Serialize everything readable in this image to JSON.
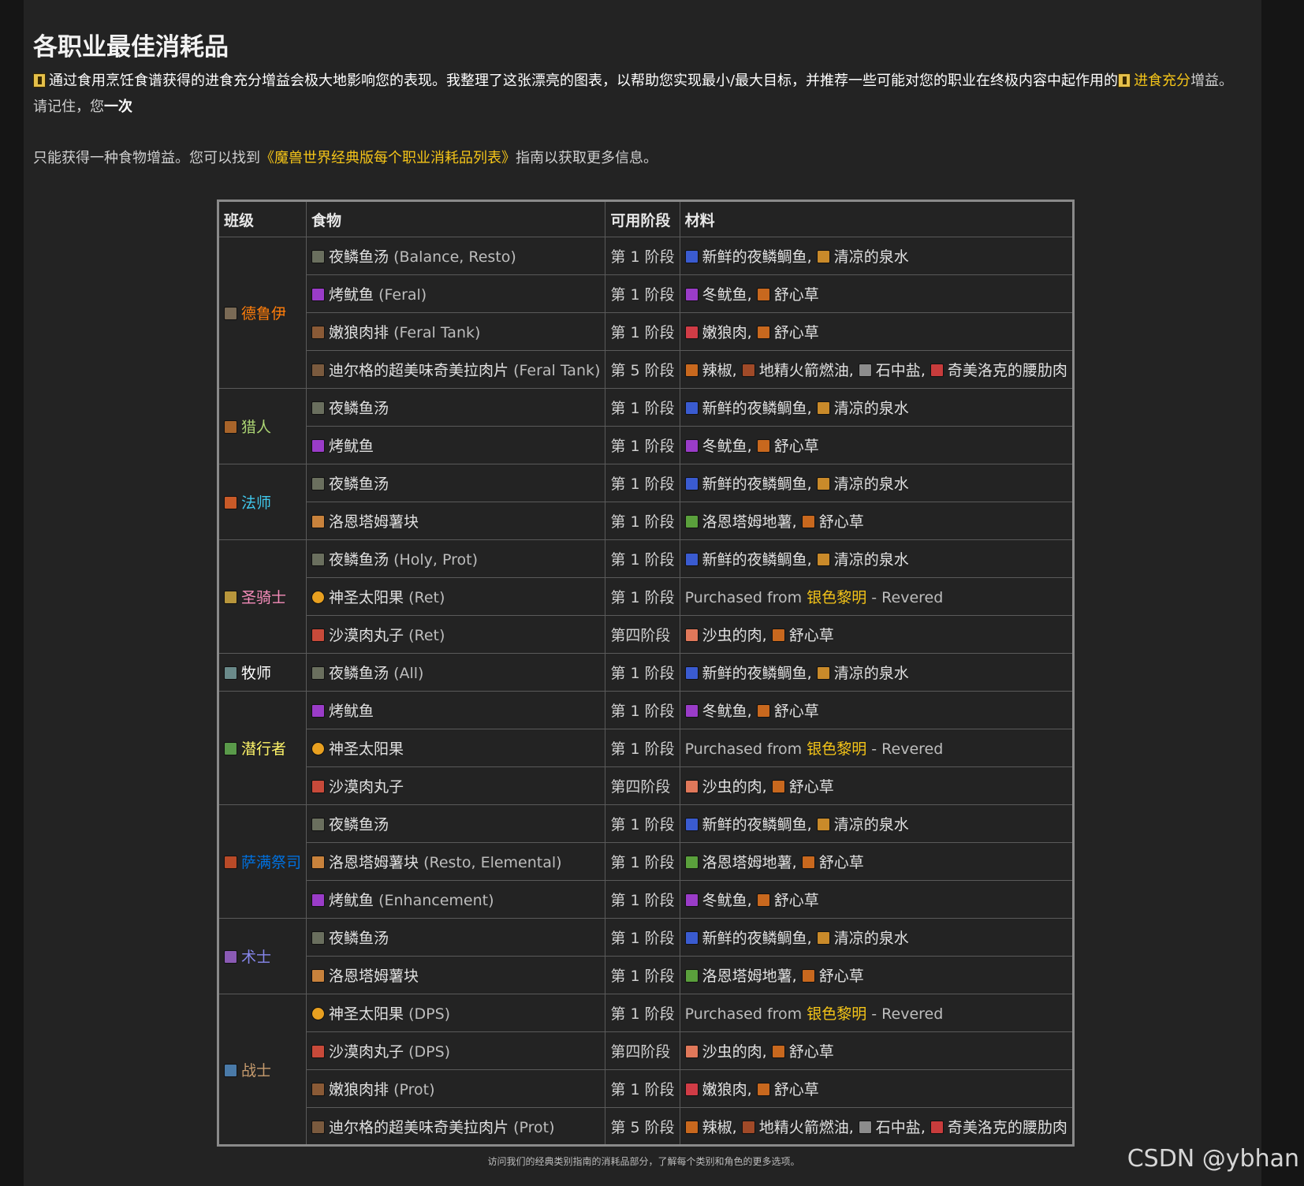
{
  "page": {
    "title": "各职业最佳消耗品",
    "intro": {
      "prefix": "通过食用烹饪食谱获得的进食充分增益会极大地影响您的表现。我整理了这张漂亮的图表，以帮助您实现最小/最大目标，并推荐一些可能对您的职业在终极内容中起作用的",
      "link": "进食充分",
      "suffix": "增益。请记住，您",
      "strong": "一次"
    },
    "line2": {
      "prefix": "只能获得一种食物增益。您可以找到",
      "link": "《魔兽世界经典版每个职业消耗品列表》",
      "suffix": "指南以获取更多信息。"
    },
    "caption": "访问我们的经典类别指南的消耗品部分，了解每个类别和角色的更多选项。",
    "watermark": "CSDN @ybhan"
  },
  "table": {
    "headers": [
      "班级",
      "食物",
      "可用阶段",
      "材料"
    ],
    "purchase": {
      "prefix": "Purchased from ",
      "faction": "银色黎明",
      "suffix": " - Revered"
    },
    "groups": [
      {
        "cls": "德鲁伊",
        "color": "#ff7d0a",
        "icon": "#7a6a55",
        "rows": [
          {
            "food": "夜鳞鱼汤",
            "note": " (Balance, Resto)",
            "ficon": "#6a6f5e",
            "phase": "第 1 阶段",
            "pc": "",
            "mats": [
              {
                "n": "新鲜的夜鳞鲷鱼",
                "c": "#3a5bd0"
              },
              {
                "n": "清凉的泉水",
                "c": "#c98a2a"
              }
            ]
          },
          {
            "food": "烤鱿鱼",
            "note": " (Feral)",
            "ficon": "#9a3cc8",
            "phase": "第 1 阶段",
            "pc": "",
            "mats": [
              {
                "n": "冬鱿鱼",
                "c": "#9a3cc8"
              },
              {
                "n": "舒心草",
                "c": "#c8681e"
              }
            ]
          },
          {
            "food": "嫩狼肉排",
            "note": " (Feral Tank)",
            "ficon": "#8a5a36",
            "phase": "第 1 阶段",
            "pc": "",
            "mats": [
              {
                "n": "嫩狼肉",
                "c": "#d03c46"
              },
              {
                "n": "舒心草",
                "c": "#c8681e"
              }
            ]
          },
          {
            "food": "迪尔格的超美味奇美拉肉片",
            "note": " (Feral Tank)",
            "ficon": "#7a5a3e",
            "phase": "第 5 阶段",
            "pc": "o",
            "mats": [
              {
                "n": "辣椒",
                "c": "#c8681e"
              },
              {
                "n": "地精火箭燃油",
                "c": "#a04a28"
              },
              {
                "n": "石中盐",
                "c": "#8c8c8c"
              },
              {
                "n": "奇美洛克的腰肋肉",
                "c": "#c83c3c"
              }
            ]
          }
        ]
      },
      {
        "cls": "猎人",
        "color": "#abd473",
        "icon": "#a8642a",
        "rows": [
          {
            "food": "夜鳞鱼汤",
            "note": "",
            "ficon": "#6a6f5e",
            "phase": "第 1 阶段",
            "pc": "",
            "mats": [
              {
                "n": "新鲜的夜鳞鲷鱼",
                "c": "#3a5bd0"
              },
              {
                "n": "清凉的泉水",
                "c": "#c98a2a"
              }
            ]
          },
          {
            "food": "烤鱿鱼",
            "note": "",
            "ficon": "#9a3cc8",
            "phase": "第 1 阶段",
            "pc": "",
            "mats": [
              {
                "n": "冬鱿鱼",
                "c": "#9a3cc8"
              },
              {
                "n": "舒心草",
                "c": "#c8681e"
              }
            ]
          }
        ]
      },
      {
        "cls": "法师",
        "color": "#40c7eb",
        "icon": "#c85a28",
        "rows": [
          {
            "food": "夜鳞鱼汤",
            "note": "",
            "ficon": "#6a6f5e",
            "phase": "第 1 阶段",
            "pc": "",
            "mats": [
              {
                "n": "新鲜的夜鳞鲷鱼",
                "c": "#3a5bd0"
              },
              {
                "n": "清凉的泉水",
                "c": "#c98a2a"
              }
            ]
          },
          {
            "food": "洛恩塔姆薯块",
            "note": "",
            "ficon": "#c8823c",
            "phase": "第 1 阶段",
            "pc": "",
            "mats": [
              {
                "n": "洛恩塔姆地薯",
                "c": "#5aa03c"
              },
              {
                "n": "舒心草",
                "c": "#c8681e"
              }
            ]
          }
        ]
      },
      {
        "cls": "圣骑士",
        "color": "#f58cba",
        "icon": "#b8963c",
        "rows": [
          {
            "food": "夜鳞鱼汤",
            "note": " (Holy, Prot)",
            "ficon": "#6a6f5e",
            "phase": "第 1 阶段",
            "pc": "",
            "mats": [
              {
                "n": "新鲜的夜鳞鲷鱼",
                "c": "#3a5bd0"
              },
              {
                "n": "清凉的泉水",
                "c": "#c98a2a"
              }
            ]
          },
          {
            "food": "神圣太阳果",
            "note": " (Ret)",
            "ficon": "#e8a020",
            "round": true,
            "phase": "第 1 阶段",
            "pc": "",
            "purchase": true
          },
          {
            "food": "沙漠肉丸子",
            "note": " (Ret)",
            "ficon": "#c84a3a",
            "phase": "第四阶段",
            "pc": "g",
            "mats": [
              {
                "n": "沙虫的肉",
                "c": "#e0785a"
              },
              {
                "n": "舒心草",
                "c": "#c8681e"
              }
            ]
          }
        ]
      },
      {
        "cls": "牧师",
        "color": "#ffffff",
        "icon": "#6a8a8a",
        "rows": [
          {
            "food": "夜鳞鱼汤",
            "note": " (All)",
            "ficon": "#6a6f5e",
            "phase": "第 1 阶段",
            "pc": "",
            "mats": [
              {
                "n": "新鲜的夜鳞鲷鱼",
                "c": "#3a5bd0"
              },
              {
                "n": "清凉的泉水",
                "c": "#c98a2a"
              }
            ]
          }
        ]
      },
      {
        "cls": "潜行者",
        "color": "#fff569",
        "icon": "#5a9a4a",
        "rows": [
          {
            "food": "烤鱿鱼",
            "note": "",
            "ficon": "#9a3cc8",
            "phase": "第 1 阶段",
            "pc": "",
            "mats": [
              {
                "n": "冬鱿鱼",
                "c": "#9a3cc8"
              },
              {
                "n": "舒心草",
                "c": "#c8681e"
              }
            ]
          },
          {
            "food": "神圣太阳果",
            "note": "",
            "ficon": "#e8a020",
            "round": true,
            "phase": "第 1 阶段",
            "pc": "",
            "purchase": true
          },
          {
            "food": "沙漠肉丸子",
            "note": "",
            "ficon": "#c84a3a",
            "phase": "第四阶段",
            "pc": "g",
            "mats": [
              {
                "n": "沙虫的肉",
                "c": "#e0785a"
              },
              {
                "n": "舒心草",
                "c": "#c8681e"
              }
            ]
          }
        ]
      },
      {
        "cls": "萨满祭司",
        "color": "#0070de",
        "icon": "#b84a28",
        "rows": [
          {
            "food": "夜鳞鱼汤",
            "note": "",
            "ficon": "#6a6f5e",
            "phase": "第 1 阶段",
            "pc": "",
            "mats": [
              {
                "n": "新鲜的夜鳞鲷鱼",
                "c": "#3a5bd0"
              },
              {
                "n": "清凉的泉水",
                "c": "#c98a2a"
              }
            ]
          },
          {
            "food": "洛恩塔姆薯块",
            "note": " (Resto, Elemental)",
            "ficon": "#c8823c",
            "phase": "第 1 阶段",
            "pc": "",
            "mats": [
              {
                "n": "洛恩塔姆地薯",
                "c": "#5aa03c"
              },
              {
                "n": "舒心草",
                "c": "#c8681e"
              }
            ]
          },
          {
            "food": "烤鱿鱼",
            "note": " (Enhancement)",
            "ficon": "#9a3cc8",
            "phase": "第 1 阶段",
            "pc": "",
            "mats": [
              {
                "n": "冬鱿鱼",
                "c": "#9a3cc8"
              },
              {
                "n": "舒心草",
                "c": "#c8681e"
              }
            ]
          }
        ]
      },
      {
        "cls": "术士",
        "color": "#8787ed",
        "icon": "#8a5ab4",
        "rows": [
          {
            "food": "夜鳞鱼汤",
            "note": "",
            "ficon": "#6a6f5e",
            "phase": "第 1 阶段",
            "pc": "",
            "mats": [
              {
                "n": "新鲜的夜鳞鲷鱼",
                "c": "#3a5bd0"
              },
              {
                "n": "清凉的泉水",
                "c": "#c98a2a"
              }
            ]
          },
          {
            "food": "洛恩塔姆薯块",
            "note": "",
            "ficon": "#c8823c",
            "phase": "第 1 阶段",
            "pc": "",
            "mats": [
              {
                "n": "洛恩塔姆地薯",
                "c": "#5aa03c"
              },
              {
                "n": "舒心草",
                "c": "#c8681e"
              }
            ]
          }
        ]
      },
      {
        "cls": "战士",
        "color": "#c79c6e",
        "icon": "#4a7aa8",
        "rows": [
          {
            "food": "神圣太阳果",
            "note": " (DPS)",
            "ficon": "#e8a020",
            "round": true,
            "phase": "第 1 阶段",
            "pc": "",
            "purchase": true
          },
          {
            "food": "沙漠肉丸子",
            "note": " (DPS)",
            "ficon": "#c84a3a",
            "phase": "第四阶段",
            "pc": "g",
            "mats": [
              {
                "n": "沙虫的肉",
                "c": "#e0785a"
              },
              {
                "n": "舒心草",
                "c": "#c8681e"
              }
            ]
          },
          {
            "food": "嫩狼肉排",
            "note": " (Prot)",
            "ficon": "#8a5a36",
            "phase": "第 1 阶段",
            "pc": "",
            "mats": [
              {
                "n": "嫩狼肉",
                "c": "#d03c46"
              },
              {
                "n": "舒心草",
                "c": "#c8681e"
              }
            ]
          },
          {
            "food": "迪尔格的超美味奇美拉肉片",
            "note": " (Prot)",
            "ficon": "#7a5a3e",
            "phase": "第 5 阶段",
            "pc": "o",
            "mats": [
              {
                "n": "辣椒",
                "c": "#c8681e"
              },
              {
                "n": "地精火箭燃油",
                "c": "#a04a28"
              },
              {
                "n": "石中盐",
                "c": "#8c8c8c"
              },
              {
                "n": "奇美洛克的腰肋肉",
                "c": "#c83c3c"
              }
            ]
          }
        ]
      }
    ]
  }
}
